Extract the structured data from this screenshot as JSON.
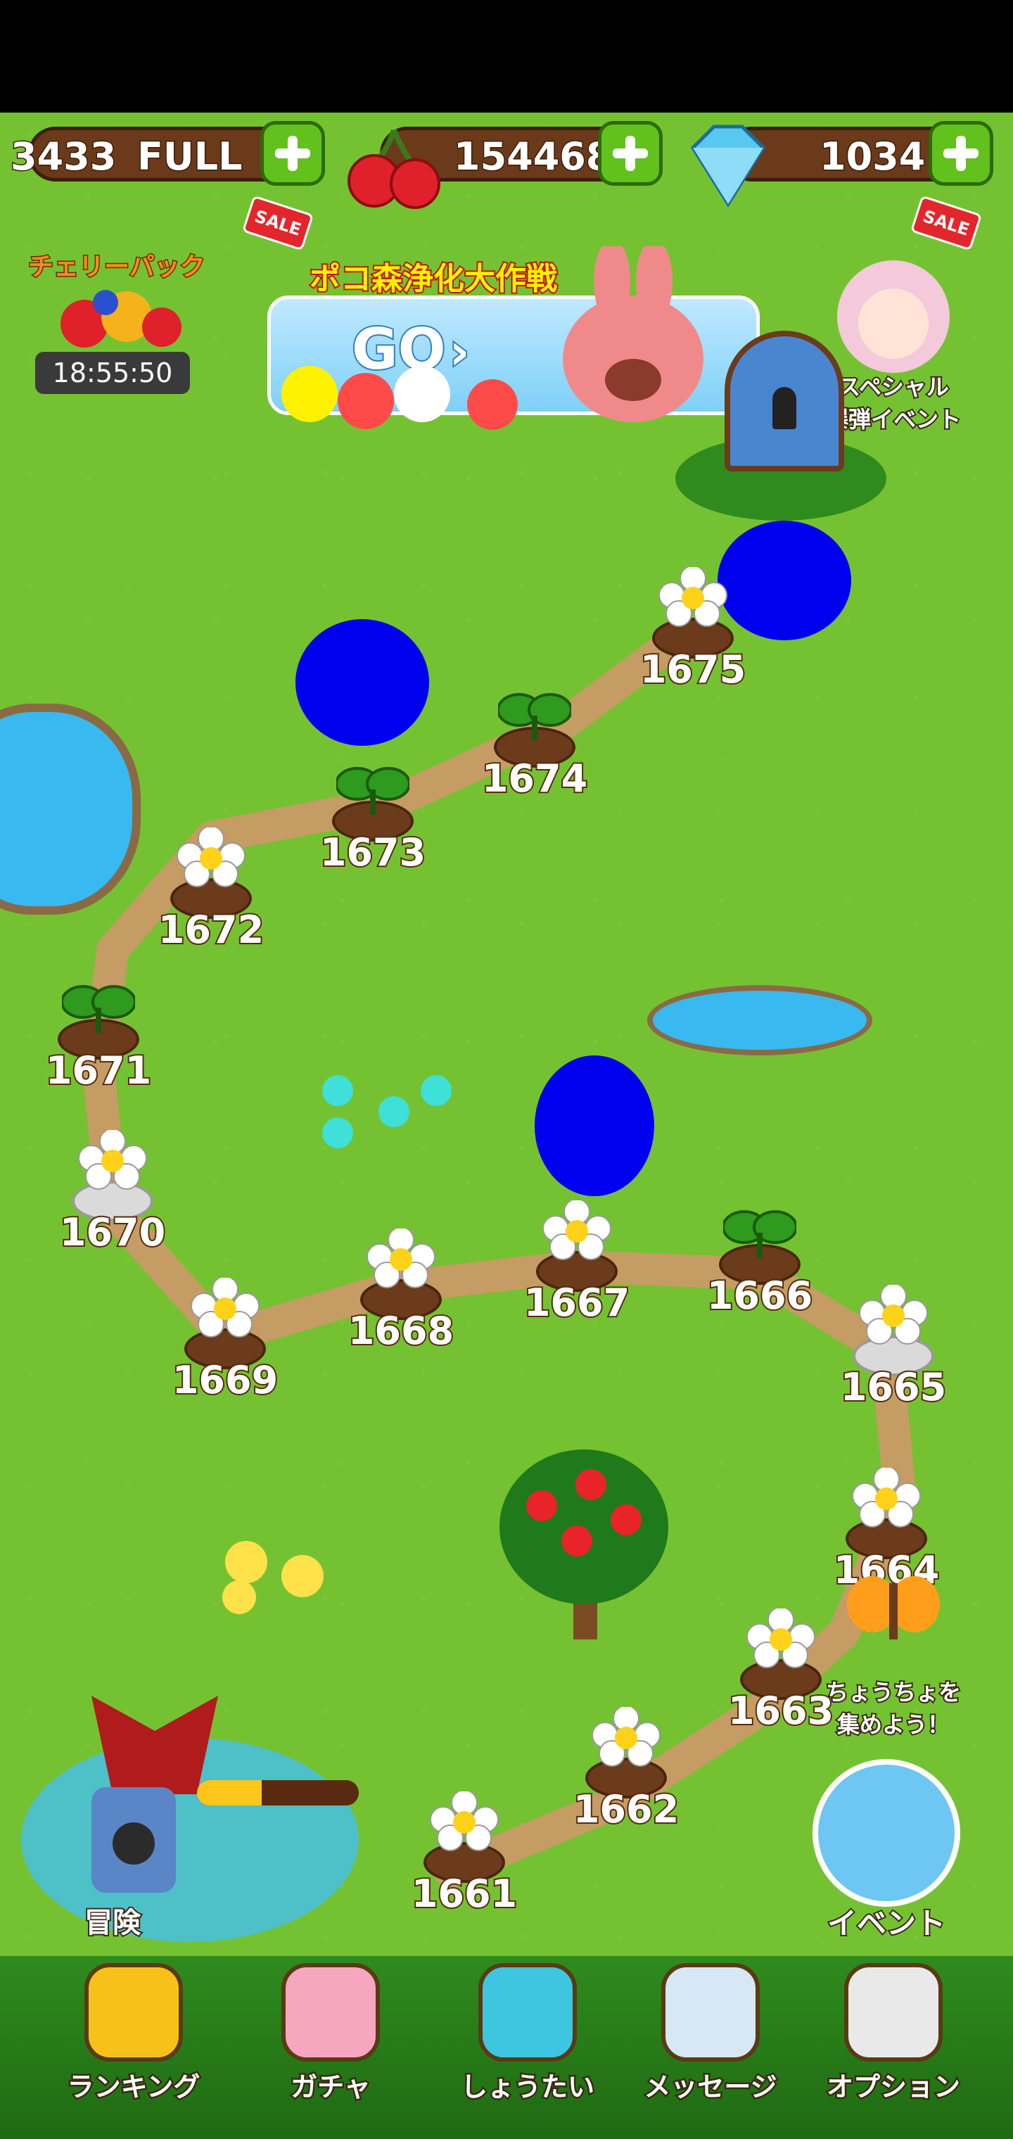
{
  "hud": {
    "hearts": {
      "value": "3433",
      "status": "FULL",
      "sale": "SALE"
    },
    "cherries": {
      "value": "154468"
    },
    "gems": {
      "value": "1034",
      "sale": "SALE"
    }
  },
  "promo": {
    "cherry_pack": {
      "title": "チェリーパック",
      "timer": "18:55:50"
    },
    "banner": {
      "title": "ポコ森浄化大作戦",
      "go_label": "GO"
    },
    "special": {
      "label": "スペシャル\n爆弾イベント"
    }
  },
  "levels": [
    {
      "number": "1675",
      "kind": "flower"
    },
    {
      "number": "1674",
      "kind": "sprout"
    },
    {
      "number": "1673",
      "kind": "sprout"
    },
    {
      "number": "1672",
      "kind": "flower"
    },
    {
      "number": "1671",
      "kind": "sprout"
    },
    {
      "number": "1670",
      "kind": "flower-stone"
    },
    {
      "number": "1669",
      "kind": "flower"
    },
    {
      "number": "1668",
      "kind": "flower"
    },
    {
      "number": "1667",
      "kind": "flower"
    },
    {
      "number": "1666",
      "kind": "sprout"
    },
    {
      "number": "1665",
      "kind": "flower-stone"
    },
    {
      "number": "1664",
      "kind": "flower"
    },
    {
      "number": "1663",
      "kind": "flower"
    },
    {
      "number": "1662",
      "kind": "flower"
    },
    {
      "number": "1661",
      "kind": "flower"
    }
  ],
  "side": {
    "butterfly": {
      "label": "ちょうちょを\n集めよう！"
    },
    "event": {
      "label": "イベント"
    },
    "adventure": {
      "label": "冒険",
      "progress": 0.4
    }
  },
  "nav": [
    {
      "label": "ランキング",
      "icon": "trophy-icon"
    },
    {
      "label": "ガチャ",
      "icon": "bunny-icon"
    },
    {
      "label": "しょうたい",
      "icon": "invite-icon"
    },
    {
      "label": "メッセージ",
      "icon": "envelope-icon"
    },
    {
      "label": "オプション",
      "icon": "gear-icon"
    }
  ],
  "colors": {
    "grass": "#74c232",
    "path": "#c8a26a",
    "accent_green": "#62c11c",
    "sale_red": "#e3262c"
  }
}
